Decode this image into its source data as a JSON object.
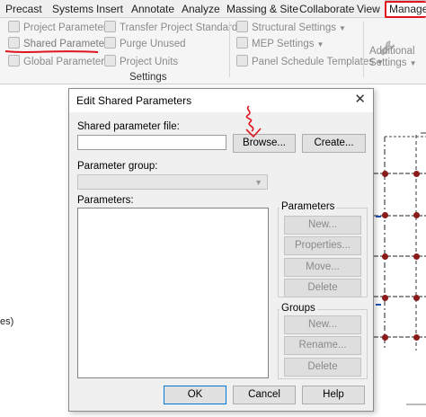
{
  "ribbon": {
    "tabs": [
      "Precast",
      "Systems",
      "Insert",
      "Annotate",
      "Analyze",
      "Massing & Site",
      "Collaborate",
      "View",
      "Manage"
    ],
    "active_tab": "Manage",
    "settings_panel": {
      "project_parameters": "Project Parameters",
      "shared_parameters": "Shared Parameters",
      "global_parameters": "Global Parameters",
      "transfer_project_standards": "Transfer Project Standards",
      "purge_unused": "Purge Unused",
      "project_units": "Project Units",
      "structural_settings": "Structural Settings",
      "mep_settings": "MEP Settings",
      "panel_schedule_templates": "Panel Schedule Templates",
      "additional_settings_line1": "Additional",
      "additional_settings_line2": "Settings",
      "group_label": "Settings"
    }
  },
  "canvas": {
    "left_text": "es)"
  },
  "dialog": {
    "title": "Edit Shared Parameters",
    "close_glyph": "✕",
    "shared_parameter_file_label": "Shared parameter file:",
    "shared_parameter_file_value": "",
    "browse_label": "Browse...",
    "create_label": "Create...",
    "parameter_group_label": "Parameter group:",
    "parameter_group_value": "",
    "parameters_list_label": "Parameters:",
    "parameters_group": {
      "label": "Parameters",
      "new": "New...",
      "properties": "Properties...",
      "move": "Move...",
      "delete": "Delete"
    },
    "groups_group": {
      "label": "Groups",
      "new": "New...",
      "rename": "Rename...",
      "delete": "Delete"
    },
    "ok_label": "OK",
    "cancel_label": "Cancel",
    "help_label": "Help"
  },
  "colors": {
    "annotation_red": "#e0141e",
    "dot_red": "#8b1a1a",
    "focus_blue": "#0078d7"
  }
}
